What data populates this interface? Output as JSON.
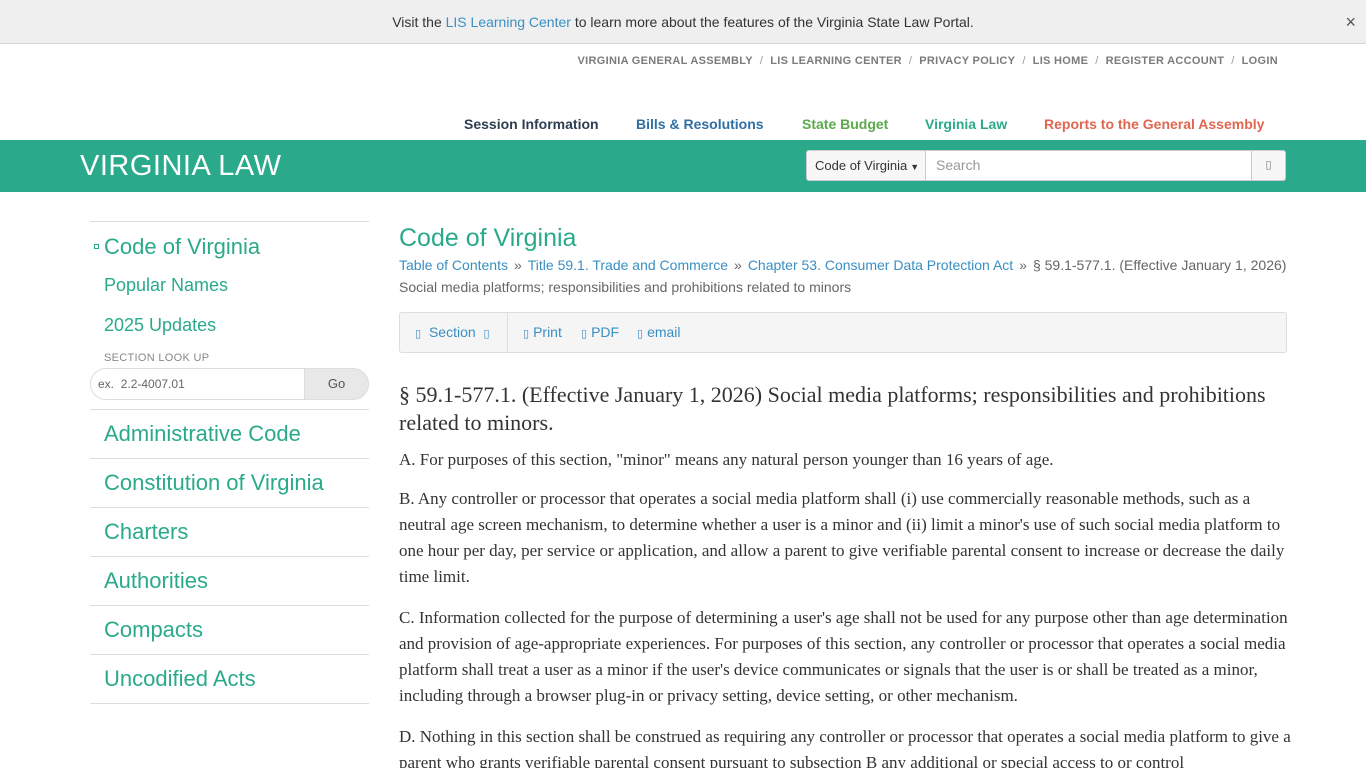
{
  "notice": {
    "prefix": "Visit the ",
    "link": "LIS Learning Center",
    "suffix": " to learn more about the features of the Virginia State Law Portal.",
    "close": "×"
  },
  "utility_links": [
    "VIRGINIA GENERAL ASSEMBLY",
    "LIS LEARNING CENTER",
    "PRIVACY POLICY",
    "LIS HOME",
    "REGISTER ACCOUNT",
    "LOGIN"
  ],
  "utility_sep": "/",
  "main_nav": [
    {
      "label": "Session Information",
      "color": "#2d3e50"
    },
    {
      "label": "Bills & Resolutions",
      "color": "#2f6fa3"
    },
    {
      "label": "State Budget",
      "color": "#5aaa4a"
    },
    {
      "label": "Virginia Law",
      "color": "#2aaa8a"
    },
    {
      "label": "Reports to the General Assembly",
      "color": "#e0664f"
    }
  ],
  "header": {
    "brand": "VIRGINIA LAW",
    "search_scope": "Code of Virginia",
    "search_placeholder": "Search",
    "accent": "#2aaa8a"
  },
  "sidebar": {
    "current": "Code of Virginia",
    "sub_items": [
      "Popular Names",
      "2025 Updates"
    ],
    "lookup_title": "SECTION LOOK UP",
    "lookup_prefix": "ex.",
    "lookup_placeholder": "2.2-4007.01",
    "lookup_go": "Go",
    "codes": [
      "Administrative Code",
      "Constitution of Virginia",
      "Charters",
      "Authorities",
      "Compacts",
      "Uncodified Acts"
    ]
  },
  "content": {
    "heading": "Code of Virginia",
    "breadcrumb": {
      "links": [
        "Table of Contents",
        "Title 59.1. Trade and Commerce",
        "Chapter 53. Consumer Data Protection Act"
      ],
      "separator": "»",
      "current": "§ 59.1-577.1. (Effective January 1, 2026) Social media platforms; responsibilities and prohibitions related to minors"
    },
    "toolbar": {
      "section": "Section",
      "print": "Print",
      "pdf": "PDF",
      "email": "email"
    },
    "section_title": "§ 59.1-577.1. (Effective January 1, 2026) Social media platforms; responsibilities and prohibitions related to minors.",
    "paragraphs": [
      "A. For purposes of this section, \"minor\" means any natural person younger than 16 years of age.",
      "B. Any controller or processor that operates a social media platform shall (i) use commercially reasonable methods, such as a neutral age screen mechanism, to determine whether a user is a minor and (ii) limit a minor's use of such social media platform to one hour per day, per service or application, and allow a parent to give verifiable parental consent to increase or decrease the daily time limit.",
      "C. Information collected for the purpose of determining a user's age shall not be used for any purpose other than age determination and provision of age-appropriate experiences. For purposes of this section, any controller or processor that operates a social media platform shall treat a user as a minor if the user's device communicates or signals that the user is or shall be treated as a minor, including through a browser plug-in or privacy setting, device setting, or other mechanism.",
      "D. Nothing in this section shall be construed as requiring any controller or processor that operates a social media platform to give a parent who grants verifiable parental consent pursuant to subsection B any additional or special access to or control"
    ]
  }
}
